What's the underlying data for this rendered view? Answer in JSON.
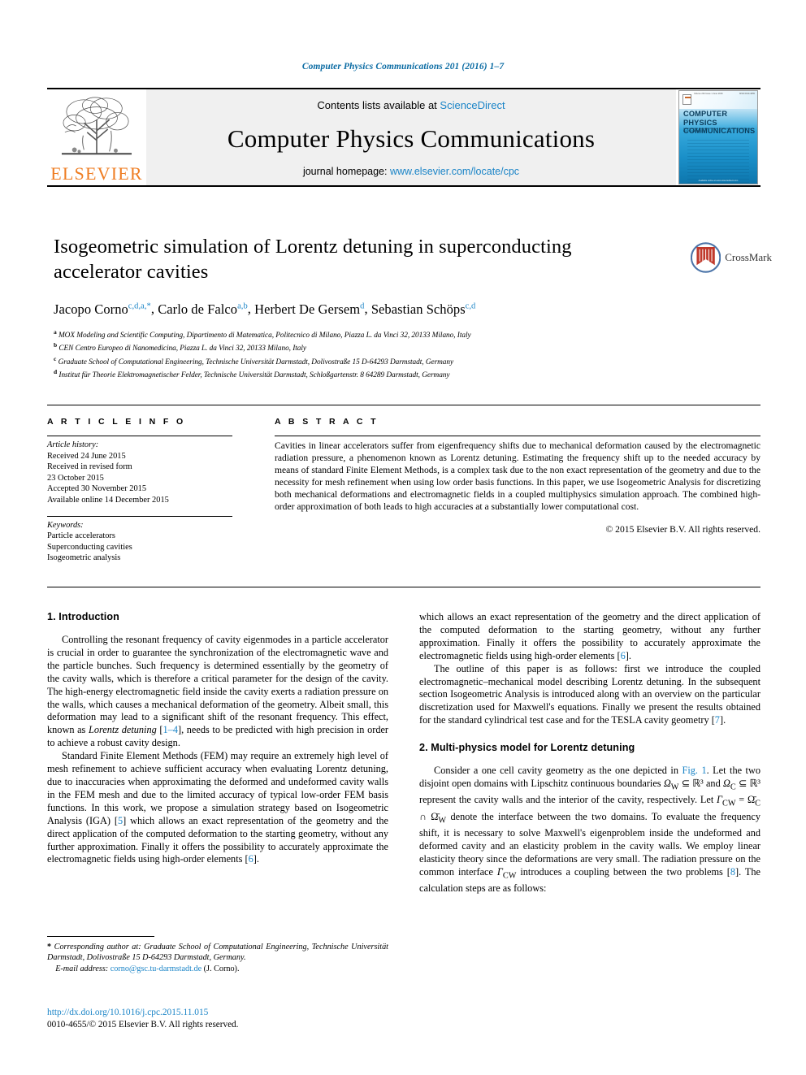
{
  "running_head": "Computer Physics Communications 201 (2016) 1–7",
  "masthead": {
    "publisher_name": "ELSEVIER",
    "contents_prefix": "Contents lists available at ",
    "contents_link": "ScienceDirect",
    "journal_title": "Computer Physics Communications",
    "homepage_prefix": "journal homepage: ",
    "homepage_url": "www.elsevier.com/locate/cpc",
    "cover": {
      "line1": "COMPUTER PHYSICS",
      "line2": "COMMUNICATIONS",
      "tagline": "An International Journal and Program Library for Computational Physics and Physical Chemistry",
      "top_left": "Volume 201 Issue 1 June 2016",
      "top_right": "ISSN 0010-4655",
      "footer": "Available online at www.sciencedirect.com"
    }
  },
  "article": {
    "title": "Isogeometric simulation of Lorentz detuning in superconducting accelerator cavities",
    "authors": [
      {
        "name": "Jacopo Corno",
        "marks": "c,d,a,",
        "star": "*"
      },
      {
        "name": "Carlo de Falco",
        "marks": "a,b",
        "star": ""
      },
      {
        "name": "Herbert De Gersem",
        "marks": "d",
        "star": ""
      },
      {
        "name": "Sebastian Schöps",
        "marks": "c,d",
        "star": ""
      }
    ],
    "affiliations": [
      {
        "mark": "a",
        "text": "MOX Modeling and Scientific Computing, Dipartimento di Matematica, Politecnico di Milano, Piazza L. da Vinci 32, 20133 Milano, Italy"
      },
      {
        "mark": "b",
        "text": "CEN Centro Europeo di Nanomedicina, Piazza L. da Vinci 32, 20133 Milano, Italy"
      },
      {
        "mark": "c",
        "text": "Graduate School of Computational Engineering, Technische Universität Darmstadt, Dolivostraße 15 D-64293 Darmstadt, Germany"
      },
      {
        "mark": "d",
        "text": "Institut für Theorie Elektromagnetischer Felder, Technische Universität Darmstadt, Schloßgartenstr. 8 64289 Darmstadt, Germany"
      }
    ],
    "crossmark_label": "CrossMark"
  },
  "article_info": {
    "heading": "A R T I C L E    I N F O",
    "history_label": "Article history:",
    "history": [
      "Received 24 June 2015",
      "Received in revised form",
      "23 October 2015",
      "Accepted 30 November 2015",
      "Available online 14 December 2015"
    ],
    "keywords_label": "Keywords:",
    "keywords": [
      "Particle accelerators",
      "Superconducting cavities",
      "Isogeometric analysis"
    ]
  },
  "abstract": {
    "heading": "A B S T R A C T",
    "text": "Cavities in linear accelerators suffer from eigenfrequency shifts due to mechanical deformation caused by the electromagnetic radiation pressure, a phenomenon known as Lorentz detuning. Estimating the frequency shift up to the needed accuracy by means of standard Finite Element Methods, is a complex task due to the non exact representation of the geometry and due to the necessity for mesh refinement when using low order basis functions. In this paper, we use Isogeometric Analysis for discretizing both mechanical deformations and electromagnetic fields in a coupled multiphysics simulation approach. The combined high-order approximation of both leads to high accuracies at a substantially lower computational cost.",
    "copyright": "© 2015 Elsevier B.V. All rights reserved."
  },
  "sections": {
    "intro_heading": "1. Introduction",
    "intro_p1_a": "Controlling the resonant frequency of cavity eigenmodes in a particle accelerator is crucial in order to guarantee the synchronization of the electromagnetic wave and the particle bunches. Such frequency is determined essentially by the geometry of the cavity walls, which is therefore a critical parameter for the design of the cavity. The high-energy electromagnetic field inside the cavity exerts a radiation pressure on the walls, which causes a mechanical deformation of the geometry. Albeit small, this deformation may lead to a significant shift of the resonant frequency. This effect, known as ",
    "intro_p1_italic": "Lorentz detuning",
    "intro_p1_ref": "1–4",
    "intro_p1_b": ", needs to be predicted with high precision in order to achieve a robust cavity design.",
    "intro_p2_a": "Standard Finite Element Methods (FEM) may require an extremely high level of mesh refinement to achieve sufficient accuracy when evaluating Lorentz detuning, due to inaccuracies when approximating the deformed and undeformed cavity walls in the FEM mesh and due to the limited accuracy of typical low-order FEM basis functions. In this work, we propose a simulation strategy based on Isogeometric Analysis (IGA) ",
    "intro_p2_ref": "5",
    "intro_p2_b": " which allows an exact representation of the geometry and the direct application of the computed deformation to the starting geometry, without any further approximation. Finally it offers the possibility to accurately approximate the electromagnetic fields using high-order elements ",
    "intro_p2_ref2": "6",
    "intro_p2_c": ".",
    "intro_p3_a": "The outline of this paper is as follows: first we introduce the coupled electromagnetic–mechanical model describing Lorentz detuning. In the subsequent section Isogeometric Analysis is introduced along with an overview on the particular discretization used for Maxwell's equations. Finally we present the results obtained for the standard cylindrical test case and for the TESLA cavity geometry ",
    "intro_p3_ref": "7",
    "intro_p3_b": ".",
    "sec2_heading": "2. Multi-physics model for Lorentz detuning",
    "sec2_p1_a": "Consider a one cell cavity geometry as the one depicted in ",
    "sec2_fig_ref": "Fig. 1",
    "sec2_p1_b": ". Let the two disjoint open domains with Lipschitz continuous boundaries ",
    "sec2_math1": "Ω",
    "sec2_math1_sub": "W",
    "sec2_math1_rest": " ⊆ ℝ³ and ",
    "sec2_math2": "Ω",
    "sec2_math2_sub": "C",
    "sec2_math2_rest": " ⊆ ℝ³ represent the cavity walls and the interior of the cavity, respectively. Let ",
    "sec2_math3": "Γ",
    "sec2_math3_sub": "CW",
    "sec2_math3_rest": " = Ω̄",
    "sec2_math3_sub2": "C",
    "sec2_math3_rest2": " ∩ Ω̄",
    "sec2_math3_sub3": "W",
    "sec2_p1_c": " denote the interface between the two domains. To evaluate the frequency shift, it is necessary to solve Maxwell's eigenproblem inside the undeformed and deformed cavity and an elasticity problem in the cavity walls. We employ linear elasticity theory since the deformations are very small. The radiation pressure on the common interface ",
    "sec2_math4": "Γ",
    "sec2_math4_sub": "CW",
    "sec2_p1_d": " introduces a coupling between the two problems ",
    "sec2_p1_ref": "8",
    "sec2_p1_e": ". The calculation steps are as follows:"
  },
  "footnote": {
    "star": "*",
    "text_a": "Corresponding author at: Graduate School of Computational Engineering, Technische Universität Darmstadt, Dolivostraße 15 D-64293 Darmstadt, Germany.",
    "email_label": "E-mail address:",
    "email": "corno@gsc.tu-darmstadt.de",
    "email_suffix": "(J. Corno)."
  },
  "footer": {
    "doi": "http://dx.doi.org/10.1016/j.cpc.2015.11.015",
    "issn": "0010-4655/© 2015 Elsevier B.V. All rights reserved."
  },
  "colors": {
    "link": "#1a84c7",
    "running_head": "#0a6ba3",
    "elsevier_orange": "#ef7d22"
  }
}
